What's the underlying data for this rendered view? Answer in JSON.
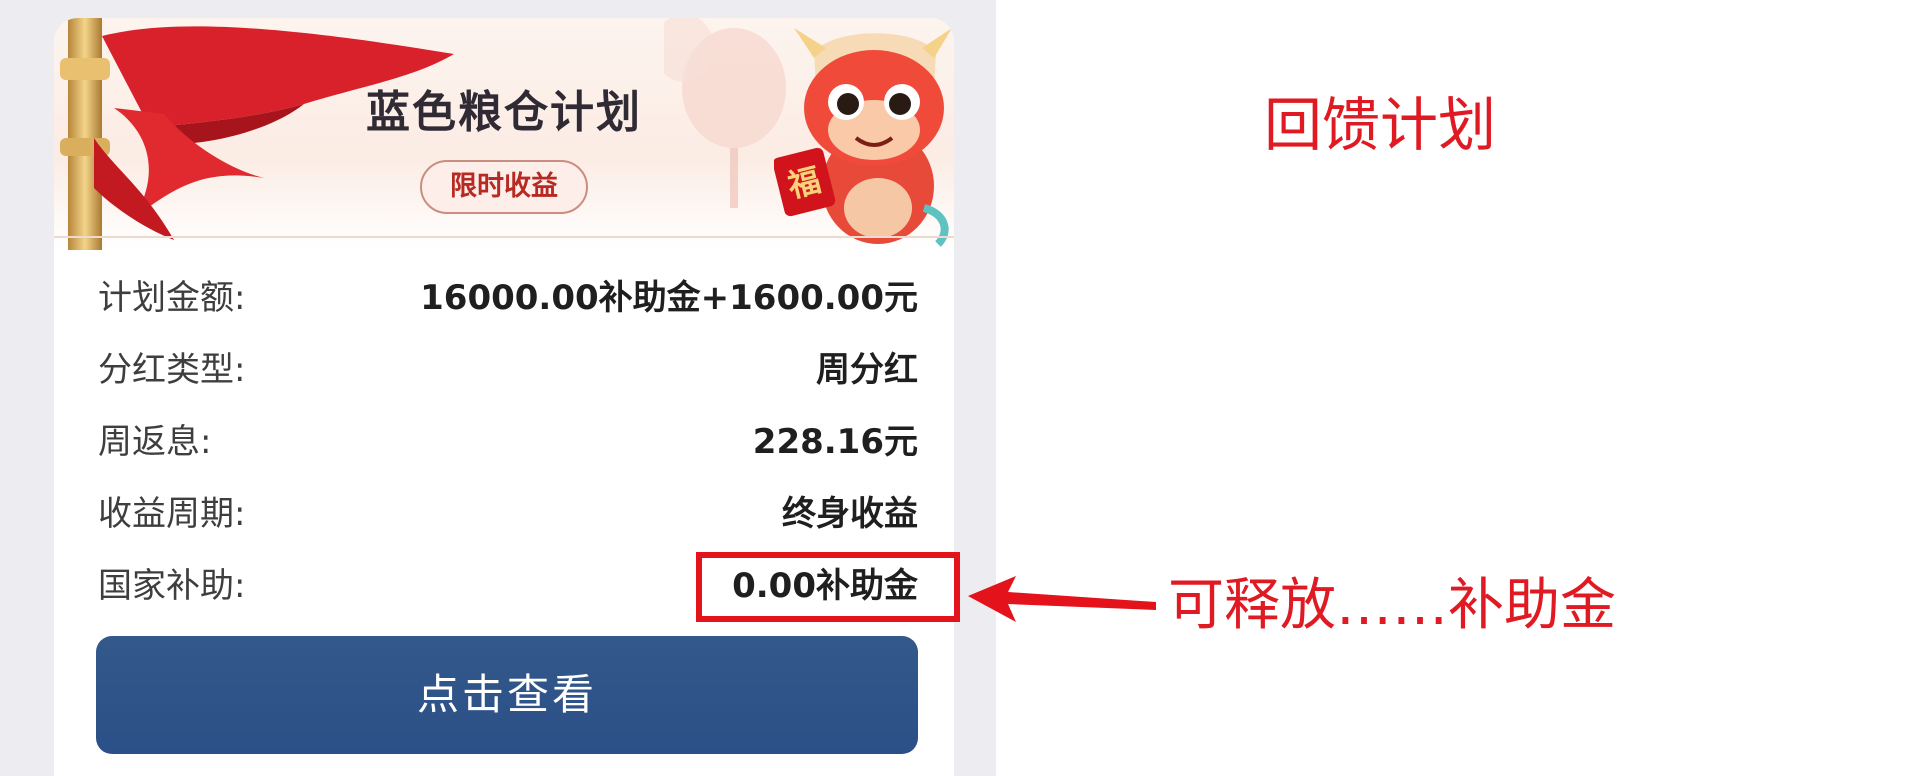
{
  "plan_card": {
    "title": "蓝色粮仓计划",
    "badge": "限时收益",
    "rows": [
      {
        "label": "计划金额:",
        "value": "16000.00补助金+1600.00元"
      },
      {
        "label": "分红类型:",
        "value": "周分红"
      },
      {
        "label": "周返息:",
        "value": "228.16元"
      },
      {
        "label": "收益周期:",
        "value": "终身收益"
      },
      {
        "label": "国家补助:",
        "value": "0.00补助金"
      }
    ],
    "button_label": "点击查看",
    "decoration_icons": [
      "red-ribbon-icon",
      "golden-pillar-icon",
      "lantern-icon",
      "dragon-mascot-icon",
      "fu-envelope-icon"
    ],
    "badge_char": "福"
  },
  "annotations": {
    "title": "回馈计划",
    "note": "可释放……补助金",
    "color": "#e01a22"
  },
  "colors": {
    "button": "#2b5088",
    "badge_text": "#b72a23",
    "annotation": "#e01a22"
  }
}
